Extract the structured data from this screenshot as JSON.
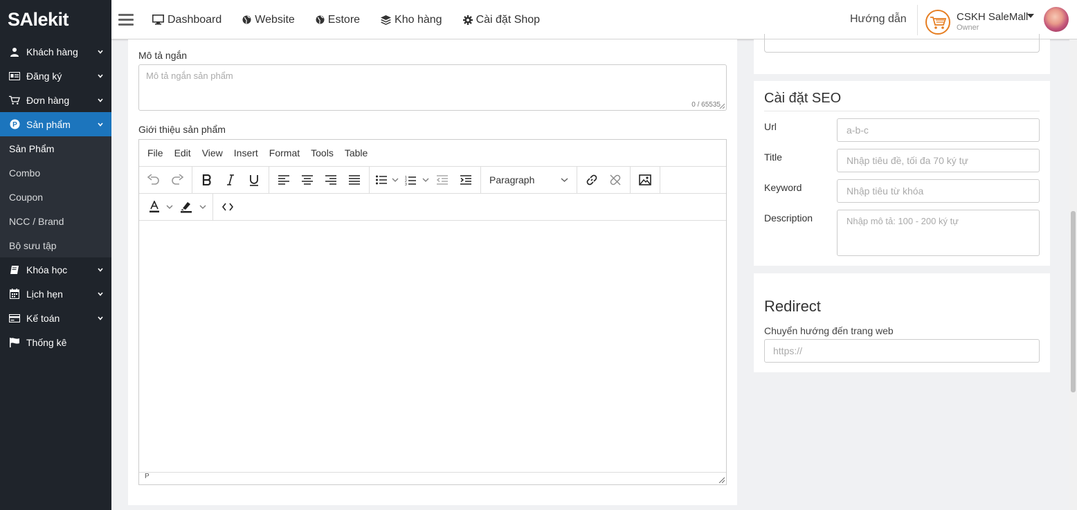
{
  "brand": {
    "logo_text": "SAlekit"
  },
  "sidebar": {
    "items": [
      {
        "label": "Khách hàng",
        "icon": "user-icon"
      },
      {
        "label": "Đăng ký",
        "icon": "id-card-icon"
      },
      {
        "label": "Đơn hàng",
        "icon": "cart-icon"
      },
      {
        "label": "Sản phẩm",
        "icon": "product-p-icon"
      },
      {
        "label": "Khóa học",
        "icon": "book-icon"
      },
      {
        "label": "Lịch hẹn",
        "icon": "calendar-icon"
      },
      {
        "label": "Kế toán",
        "icon": "credit-card-icon"
      },
      {
        "label": "Thống kê",
        "icon": "flag-icon"
      }
    ],
    "sub_items": [
      "Sản Phẩm",
      "Combo",
      "Coupon",
      "NCC / Brand",
      "Bộ sưu tập"
    ]
  },
  "topbar": {
    "nav": [
      {
        "label": "Dashboard",
        "icon": "monitor-icon"
      },
      {
        "label": "Website",
        "icon": "globe-icon"
      },
      {
        "label": "Estore",
        "icon": "globe-icon"
      },
      {
        "label": "Kho hàng",
        "icon": "layers-icon"
      },
      {
        "label": "Cài đặt Shop",
        "icon": "gear-icon"
      }
    ],
    "help": "Hướng dẫn",
    "user_name": "CSKH SaleMall",
    "user_role": "Owner"
  },
  "form": {
    "short_desc_label": "Mô tả ngắn",
    "short_desc_placeholder": "Mô tả ngắn sản phẩm",
    "short_desc_counter": "0 / 65535",
    "intro_label": "Giới thiệu sản phẩm"
  },
  "editor": {
    "menu": [
      "File",
      "Edit",
      "View",
      "Insert",
      "Format",
      "Tools",
      "Table"
    ],
    "block_format": "Paragraph",
    "status_path": "P"
  },
  "seo": {
    "title": "Cài đặt SEO",
    "fields": [
      {
        "label": "Url",
        "placeholder": "a-b-c"
      },
      {
        "label": "Title",
        "placeholder": "Nhập tiêu đề, tối đa 70 ký tự"
      },
      {
        "label": "Keyword",
        "placeholder": "Nhập tiêu từ khóa"
      },
      {
        "label": "Description",
        "placeholder": "Nhập mô tả: 100 - 200 ký tự"
      }
    ]
  },
  "redirect": {
    "title": "Redirect",
    "label": "Chuyển hướng đến trang web",
    "placeholder": "https://"
  },
  "colors": {
    "sidebar_bg": "#1f242b",
    "active_blue": "#1c75bd",
    "shop_logo": "#e67e22"
  }
}
